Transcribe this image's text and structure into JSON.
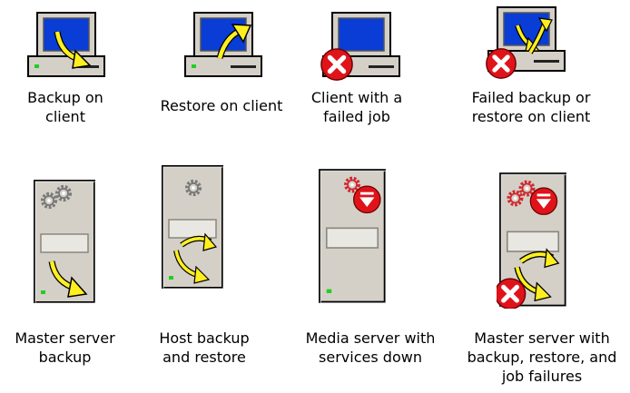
{
  "legend": {
    "row1": [
      {
        "caption_lines": [
          "Backup on",
          "client"
        ],
        "icon": "client-backup-icon"
      },
      {
        "caption_lines": [
          "Restore on client"
        ],
        "icon": "client-restore-icon"
      },
      {
        "caption_lines": [
          "Client with a",
          "failed job"
        ],
        "icon": "client-failed-job-icon"
      },
      {
        "caption_lines": [
          "Failed backup or",
          "restore on client"
        ],
        "icon": "client-failed-backup-restore-icon"
      }
    ],
    "row2": [
      {
        "caption_lines": [
          "Master server",
          "backup"
        ],
        "icon": "master-server-backup-icon"
      },
      {
        "caption_lines": [
          "Host backup",
          "and restore"
        ],
        "icon": "host-backup-restore-icon"
      },
      {
        "caption_lines": [
          "Media server with",
          "services down"
        ],
        "icon": "media-server-services-down-icon"
      },
      {
        "caption_lines": [
          "Master server with",
          "backup, restore, and",
          "job failures"
        ],
        "icon": "master-server-failures-icon"
      }
    ]
  }
}
